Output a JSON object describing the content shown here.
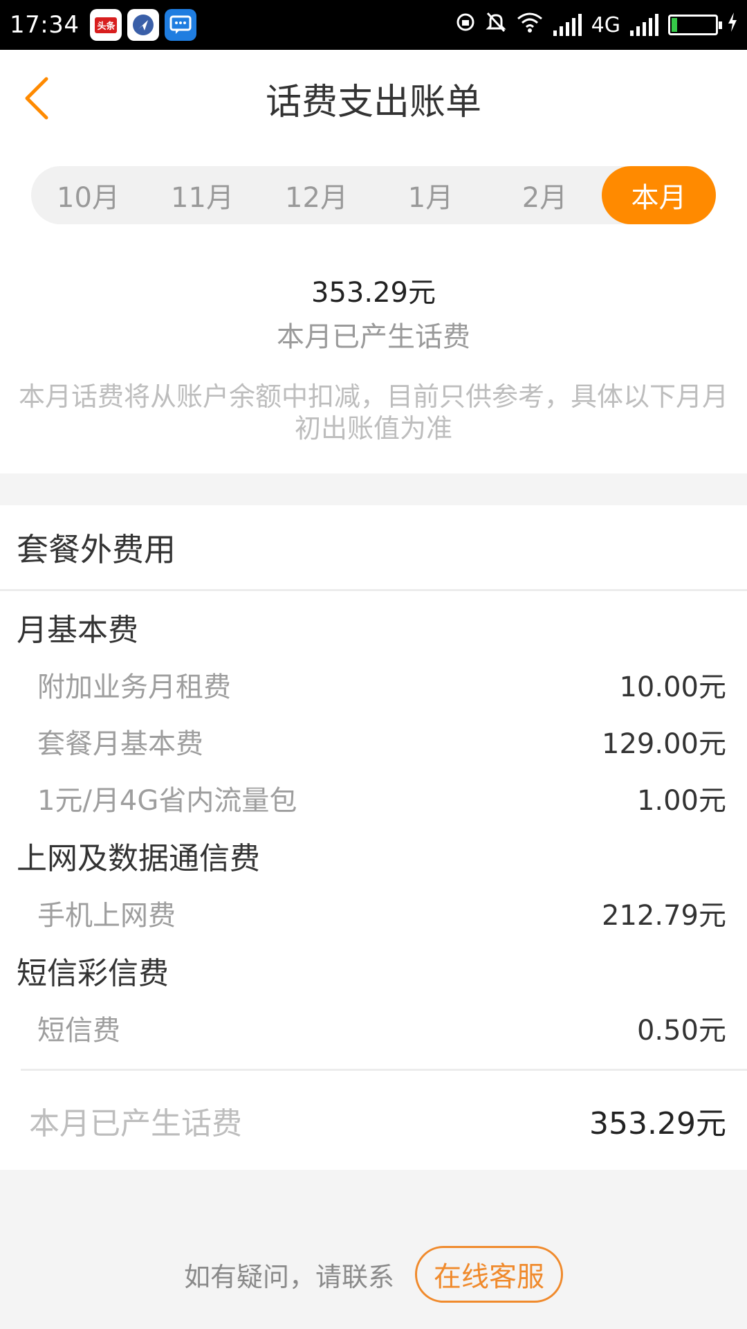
{
  "status_bar": {
    "time": "17:34",
    "network": "4G",
    "notification_icons": [
      "toutiao-icon",
      "navigation-icon",
      "message-icon"
    ],
    "status_icons": [
      "rotation-lock-icon",
      "mute-icon",
      "wifi-icon",
      "signal-icon",
      "battery-icon"
    ],
    "battery_level": 0.1
  },
  "header": {
    "title": "话费支出账单",
    "back_icon": "chevron-left-icon"
  },
  "month_tabs": [
    {
      "label": "10月",
      "active": false
    },
    {
      "label": "11月",
      "active": false
    },
    {
      "label": "12月",
      "active": false
    },
    {
      "label": "1月",
      "active": false
    },
    {
      "label": "2月",
      "active": false
    },
    {
      "label": "本月",
      "active": true
    }
  ],
  "summary": {
    "total": "353.29元",
    "label": "本月已产生话费",
    "notice": "本月话费将从账户余额中扣减，目前只供参考，具体以下月月初出账值为准"
  },
  "section": {
    "title": "套餐外费用",
    "groups": [
      {
        "title": "月基本费",
        "items": [
          {
            "name": "附加业务月租费",
            "amount": "10.00元"
          },
          {
            "name": "套餐月基本费",
            "amount": "129.00元"
          },
          {
            "name": "1元/月4G省内流量包",
            "amount": "1.00元"
          }
        ]
      },
      {
        "title": "上网及数据通信费",
        "items": [
          {
            "name": "手机上网费",
            "amount": "212.79元"
          }
        ]
      },
      {
        "title": "短信彩信费",
        "items": [
          {
            "name": "短信费",
            "amount": "0.50元"
          }
        ]
      }
    ],
    "total_label": "本月已产生话费",
    "total_amount": "353.29元"
  },
  "footer": {
    "hint": "如有疑问，请联系",
    "service_button": "在线客服"
  },
  "colors": {
    "accent": "#ff8a00",
    "service": "#f08a2c"
  }
}
